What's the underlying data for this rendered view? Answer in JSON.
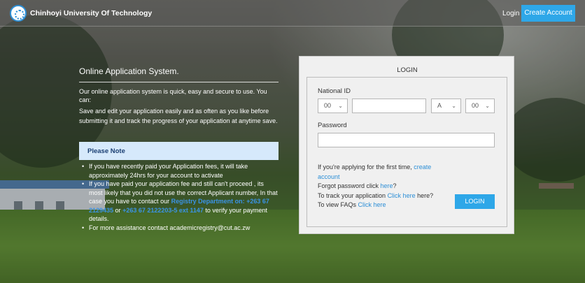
{
  "header": {
    "brand": "Chinhoyi University Of Technology",
    "login_label": "Login",
    "create_account_label": "Create Account"
  },
  "info": {
    "title": "Online Application System.",
    "intro": "Our online application system is quick, easy and secure to use. You can:",
    "body": "Save and edit your application easily and as often as you like before submitting it and track the progress of your application at anytime save.",
    "note_title": "Please Note",
    "notes": [
      {
        "text": "If you have recently paid your Application fees, it will take approximately 24hrs for your account to activate"
      },
      {
        "prefix": "If you have paid your application fee and still can't proceed , its most likely that you did not use the correct Applicant number, In that case you have to contact our ",
        "link1": "Registry Department on: +263 67 2129435",
        "mid": " or ",
        "link2": "+263 67 2122203-5 ext 1147",
        "suffix": " to verify your payment details."
      },
      {
        "text": "For more assistance contact academicregistry@cut.ac.zw"
      }
    ]
  },
  "login": {
    "heading": "LOGIN",
    "national_id_label": "National ID",
    "id_prefix_value": "00",
    "id_number_value": "",
    "id_letter_value": "A",
    "id_suffix_value": "00",
    "password_label": "Password",
    "password_value": "",
    "first_time_text": "If you're applying for the first time, ",
    "create_account_link": "create account",
    "forgot_text": "Forgot password click ",
    "forgot_link": "here",
    "forgot_suffix": "?",
    "track_text": "To track your application ",
    "track_link": "Click here",
    "track_suffix": " here?",
    "faq_text": "To view FAQs ",
    "faq_link": "Click here",
    "button_label": "LOGIN"
  },
  "icons": {
    "logo": "university-logo-icon",
    "chevron": "chevron-down-icon"
  },
  "colors": {
    "accent": "#2ea7e8",
    "note_bg": "#d6e9fb",
    "link": "#2d8fd6"
  }
}
